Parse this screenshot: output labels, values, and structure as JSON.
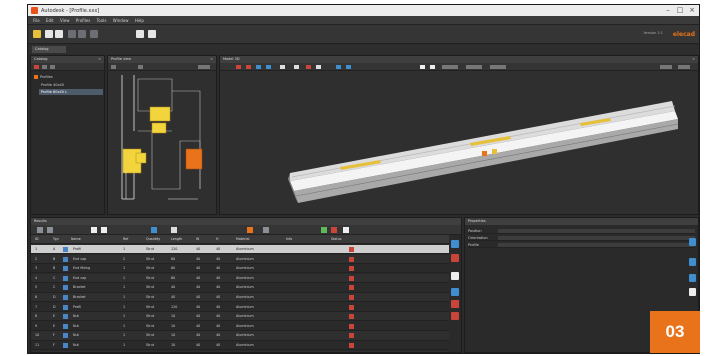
{
  "window": {
    "title": "Autodesk - [Profile.xxx]",
    "controls": [
      "–",
      "□",
      "×"
    ]
  },
  "menu": [
    "File",
    "Edit",
    "View",
    "Profiles",
    "Tools",
    "Window",
    "Help"
  ],
  "toolbar": {
    "brand": "elecad",
    "version": "Version 3.1"
  },
  "subtab": {
    "label": "Catalog"
  },
  "panels": {
    "catalog": {
      "title": "Catalog",
      "items": [
        "Profiles",
        "Profile 40x40",
        "Profile 80x40 L"
      ],
      "selected_index": 2
    },
    "profile_view": {
      "title": "Profile view"
    },
    "model_3d": {
      "title": "Model 3D"
    }
  },
  "bottom": {
    "title": "Results",
    "props_title": "Properties",
    "columns": [
      "ID",
      "Typ",
      "Name",
      "Ref",
      "Quantity",
      "Length",
      "W",
      "H",
      "Material",
      "Info",
      "Status"
    ],
    "rows": [
      [
        "1",
        "A",
        "Profil",
        "1",
        "Strut",
        "120",
        "40",
        "40",
        "Aluminium",
        "",
        ""
      ],
      [
        "2",
        "B",
        "End cap",
        "2",
        "Strut",
        "80",
        "40",
        "40",
        "Aluminium",
        "",
        ""
      ],
      [
        "3",
        "B",
        "End fitting",
        "1",
        "Strut",
        "60",
        "40",
        "40",
        "Aluminium",
        "",
        ""
      ],
      [
        "4",
        "C",
        "End cap",
        "1",
        "Strut",
        "60",
        "40",
        "40",
        "Aluminium",
        "",
        ""
      ],
      [
        "5",
        "C",
        "Bracket",
        "1",
        "Strut",
        "40",
        "40",
        "40",
        "Aluminium",
        "",
        ""
      ],
      [
        "6",
        "D",
        "Bracket",
        "1",
        "Strut",
        "40",
        "40",
        "40",
        "Aluminium",
        "",
        ""
      ],
      [
        "7",
        "D",
        "Profil",
        "1",
        "Strut",
        "120",
        "40",
        "40",
        "Aluminium",
        "",
        ""
      ],
      [
        "8",
        "E",
        "Nut",
        "1",
        "Strut",
        "10",
        "40",
        "40",
        "Aluminium",
        "",
        ""
      ],
      [
        "9",
        "E",
        "Nut",
        "1",
        "Strut",
        "10",
        "40",
        "40",
        "Aluminium",
        "",
        ""
      ],
      [
        "10",
        "F",
        "Nut",
        "1",
        "Strut",
        "10",
        "40",
        "40",
        "Aluminium",
        "",
        ""
      ],
      [
        "11",
        "F",
        "Nut",
        "1",
        "Strut",
        "10",
        "40",
        "40",
        "Aluminium",
        "",
        ""
      ],
      [
        "12",
        "G",
        "Nut",
        "1",
        "Strut",
        "10",
        "40",
        "40",
        "Aluminium",
        "",
        ""
      ]
    ],
    "selected_row": 0,
    "props": [
      "Position",
      "Orientation",
      "Profile"
    ]
  },
  "badge": "03",
  "colors": {
    "accent": "#e8731a",
    "highlight": "#e6c038",
    "bg": "#2b2b2b"
  }
}
